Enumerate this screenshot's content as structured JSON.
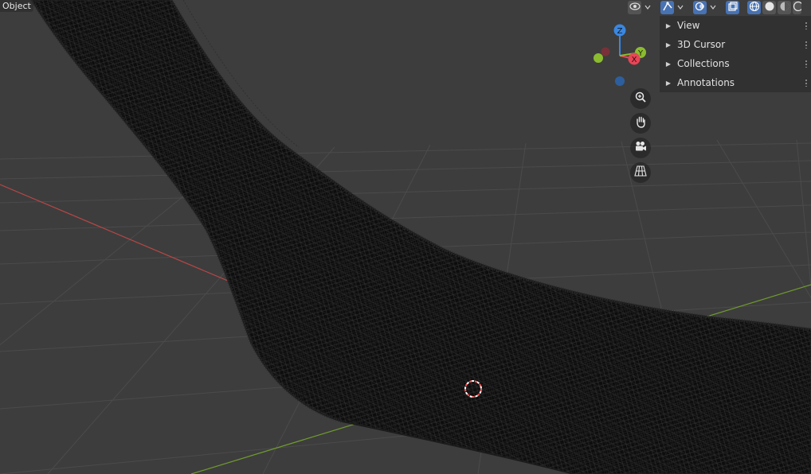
{
  "viewport": {
    "mode_label": "Object",
    "colors": {
      "background": "#3d3d3d",
      "grid": "#4a4a4a",
      "x_axis": "#b84646",
      "y_axis": "#6f9b2e",
      "mesh": "#0c0c0c",
      "cursor": "#ff5252"
    }
  },
  "header_tools": [
    {
      "icon": "eye-visibility-icon",
      "state": "normal"
    },
    {
      "icon": "chevron-down-icon",
      "state": "normal"
    },
    {
      "icon": "gizmo-toggle-icon",
      "state": "active"
    },
    {
      "icon": "chevron-down-icon",
      "state": "normal"
    },
    {
      "icon": "overlay-toggle-icon",
      "state": "active"
    },
    {
      "icon": "chevron-down-icon",
      "state": "normal"
    },
    {
      "icon": "xray-toggle-icon",
      "state": "active"
    },
    {
      "icon": "wireframe-shading-icon",
      "state": "active"
    },
    {
      "icon": "solid-shading-icon",
      "state": "normal"
    },
    {
      "icon": "material-shading-icon",
      "state": "normal"
    },
    {
      "icon": "rendered-shading-icon",
      "state": "normal"
    }
  ],
  "sidebar": {
    "panels": [
      {
        "label": "View"
      },
      {
        "label": "3D Cursor"
      },
      {
        "label": "Collections"
      },
      {
        "label": "Annotations"
      }
    ]
  },
  "gizmo": {
    "z_label": "Z",
    "y_label": "Y",
    "x_label": "X",
    "colors": {
      "x": "#e84557",
      "y": "#8bbc2f",
      "z": "#3a87e0"
    }
  },
  "nav_buttons": [
    {
      "icon": "zoom-icon"
    },
    {
      "icon": "pan-hand-icon"
    },
    {
      "icon": "camera-view-icon"
    },
    {
      "icon": "perspective-grid-icon"
    }
  ]
}
